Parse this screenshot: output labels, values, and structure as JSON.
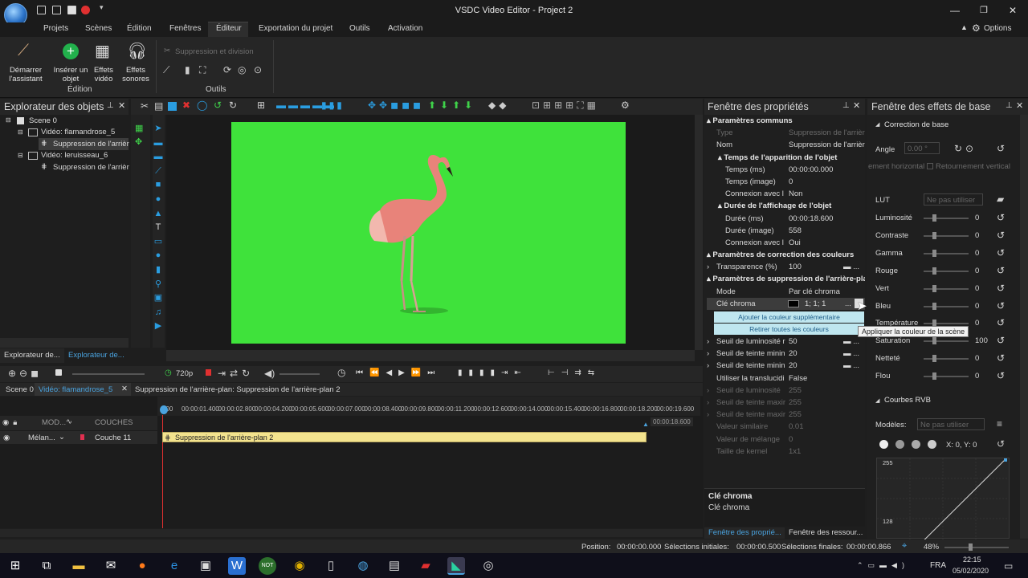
{
  "window": {
    "title": "VSDC Video Editor - Project 2"
  },
  "menu": {
    "items": [
      "Projets",
      "Scènes",
      "Édition",
      "Fenêtres",
      "Éditeur",
      "Exportation du projet",
      "Outils",
      "Activation"
    ],
    "options_label": "Options"
  },
  "ribbon": {
    "start_assistant": "Démarrer l'assistant",
    "insert_object": "Insérer un objet",
    "video_effects": "Effets vidéo",
    "sound_effects": "Effets sonores",
    "edition_group": "Édition",
    "split_label": "Suppression et division",
    "tools_group": "Outils"
  },
  "object_explorer": {
    "title": "Explorateur des objets",
    "tree": [
      {
        "label": "Scene 0",
        "level": 0
      },
      {
        "label": "Vidéo: flamandrose_5",
        "level": 1
      },
      {
        "label": "Suppression de l'arrièr",
        "level": 2
      },
      {
        "label": "Vidéo: leruisseau_6",
        "level": 1
      },
      {
        "label": "Suppression de l'arrièr",
        "level": 2
      }
    ],
    "tabs": [
      "Explorateur de...",
      "Explorateur de..."
    ]
  },
  "preview": {
    "quality": "720p"
  },
  "timeline": {
    "tabs": [
      "Scene 0",
      "Vidéo: flamandrose_5",
      "Suppression de l'arrière-plan: Suppression de l'arrière-plan 2"
    ],
    "header_cols": [
      "MOD...",
      "COUCHES"
    ],
    "layer": {
      "blend": "Mélan...",
      "name": "Couche 11"
    },
    "clip_label": "Suppression de l'arrière-plan 2",
    "ruler": [
      "00:00:01.400",
      "00:00:02.800",
      "00:00:04.200",
      "00:00:05.600",
      "00:00:07.000",
      "00:00:08.400",
      "00:00:09.800",
      "00:00:11.200",
      "00:00:12.600",
      "00:00:14.000",
      "00:00:15.400",
      "00:00:16.800",
      "00:00:18.200",
      "00:00:19.600"
    ],
    "ruler_start": "000",
    "end_marker": "00:00:18.600"
  },
  "properties": {
    "title": "Fenêtre des propriétés",
    "sections": {
      "common": "Paramètres communs",
      "appearance": "Temps de l'apparition de l'objet",
      "duration": "Durée de l'affichage de l'objet",
      "color_correction": "Paramètres de correction des couleurs",
      "bg_removal": "Paramètres de suppression de l'arrière-pla"
    },
    "rows": {
      "type": {
        "label": "Type",
        "value": "Suppression de l'arrièr"
      },
      "name": {
        "label": "Nom",
        "value": "Suppression de l'arrièr"
      },
      "time_ms": {
        "label": "Temps (ms)",
        "value": "00:00:00.000"
      },
      "time_img": {
        "label": "Temps (image)",
        "value": "0"
      },
      "conn1": {
        "label": "Connexion avec l",
        "value": "Non"
      },
      "dur_ms": {
        "label": "Durée (ms)",
        "value": "00:00:18.600"
      },
      "dur_img": {
        "label": "Durée (image)",
        "value": "558"
      },
      "conn2": {
        "label": "Connexion avec l",
        "value": "Oui"
      },
      "transparence": {
        "label": "Transparence (%)",
        "value": "100"
      },
      "mode": {
        "label": "Mode",
        "value": "Par clé chroma"
      },
      "chroma": {
        "label": "Clé chroma",
        "value": "1; 1; 1"
      },
      "lum_thresh": {
        "label": "Seuil de luminosité r",
        "value": "50"
      },
      "hue_min1": {
        "label": "Seuil de teinte minin",
        "value": "20"
      },
      "hue_min2": {
        "label": "Seuil de teinte minin",
        "value": "20"
      },
      "translucency": {
        "label": "Utiliser la translucidi",
        "value": "False"
      },
      "lum_max": {
        "label": "Seuil de luminosité",
        "value": "255"
      },
      "hue_max1": {
        "label": "Seuil de teinte maxir",
        "value": "255"
      },
      "hue_max2": {
        "label": "Seuil de teinte maxir",
        "value": "255"
      },
      "similarity": {
        "label": "Valeur similaire",
        "value": "0.01"
      },
      "blend_val": {
        "label": "Valeur de mélange",
        "value": "0"
      },
      "kernel": {
        "label": "Taille de kernel",
        "value": "1x1"
      }
    },
    "add_color": "Ajouter la couleur supplémentaire",
    "remove_colors": "Retirer toutes les couleurs",
    "tooltip": "Appliquer la couleur de la scène",
    "footer_title": "Clé chroma",
    "footer_desc": "Clé chroma",
    "tabs": [
      "Fenêtre des proprié...",
      "Fenêtre des ressour..."
    ]
  },
  "effects": {
    "title": "Fenêtre des effets de base",
    "section": "Correction de base",
    "angle_label": "Angle",
    "angle_value": "0.00 °",
    "flip_h": "ement horizontal",
    "flip_v": "Retournement vertical",
    "lut_label": "LUT",
    "lut_value": "Ne pas utiliser",
    "sliders": [
      {
        "label": "Luminosité",
        "value": "0"
      },
      {
        "label": "Contraste",
        "value": "0"
      },
      {
        "label": "Gamma",
        "value": "0"
      },
      {
        "label": "Rouge",
        "value": "0"
      },
      {
        "label": "Vert",
        "value": "0"
      },
      {
        "label": "Bleu",
        "value": "0"
      },
      {
        "label": "Température",
        "value": "0"
      },
      {
        "label": "Saturation",
        "value": "100"
      },
      {
        "label": "Netteté",
        "value": "0"
      },
      {
        "label": "Flou",
        "value": "0"
      }
    ],
    "curves_section": "Courbes RVB",
    "models_label": "Modèles:",
    "models_value": "Ne pas utiliser",
    "xy": "X: 0, Y: 0",
    "curve_max": "255",
    "curve_mid": "128"
  },
  "statusbar": {
    "position_label": "Position:",
    "position_value": "00:00:00.000",
    "sel_start_label": "Sélections initiales:",
    "sel_start_value": "00:00:00.500",
    "sel_end_label": "Sélections finales:",
    "sel_end_value": "00:00:00.866",
    "zoom": "48%"
  },
  "taskbar": {
    "lang": "FRA",
    "time": "22:15",
    "date": "05/02/2020"
  }
}
